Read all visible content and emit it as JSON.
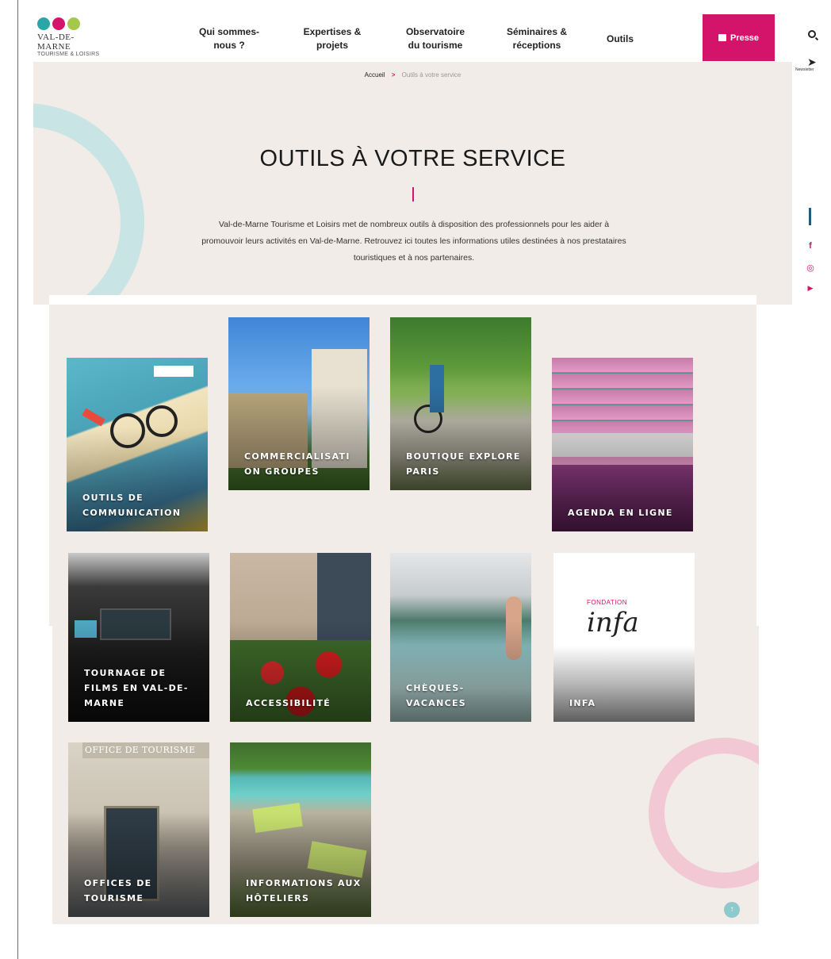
{
  "logo": {
    "name": "VAL-DE-MARNE",
    "sub": "TOURISME & LOISIRS",
    "colors": [
      "#2aa6a8",
      "#d4146b",
      "#a6c84a"
    ]
  },
  "nav": [
    {
      "line1": "Qui sommes-",
      "line2": "nous ?"
    },
    {
      "line1": "Expertises &",
      "line2": "projets"
    },
    {
      "line1": "Observatoire",
      "line2": "du tourisme"
    },
    {
      "line1": "Séminaires &",
      "line2": "réceptions"
    },
    {
      "line1": "Outils",
      "line2": ""
    }
  ],
  "presse_label": "Presse",
  "newsletter_label": "Newsletter",
  "breadcrumb": {
    "home": "Accueil",
    "sep": ">",
    "current": "Outils à votre service"
  },
  "hero": {
    "title": "OUTILS À VOTRE SERVICE",
    "description": "Val-de-Marne Tourisme et Loisirs met de nombreux outils à disposition des professionnels pour les aider à promouvoir leurs activités en Val-de-Marne. Retrouvez ici toutes les informations utiles destinées à nos prestataires touristiques et à nos partenaires."
  },
  "social": {
    "facebook": "f",
    "instagram": "◎",
    "youtube": "▶"
  },
  "tiles": [
    {
      "label": "Outils de communication"
    },
    {
      "label": "Commercialisati on groupes"
    },
    {
      "label": "Boutique Explore Paris"
    },
    {
      "label": "Agenda en ligne"
    },
    {
      "label": "Tournage de films en Val-de-Marne"
    },
    {
      "label": "Accessibilité"
    },
    {
      "label": "Chèques-vacances"
    },
    {
      "label": "INFA"
    },
    {
      "label": "Offices de tourisme"
    },
    {
      "label": "Informations aux hôteliers"
    }
  ],
  "infa": {
    "small": "FONDATION",
    "brand": "infa"
  },
  "office_sign": "OFFICE DE TOURISME",
  "accent": "#d4146b",
  "hero_bg": "#f1ece8"
}
